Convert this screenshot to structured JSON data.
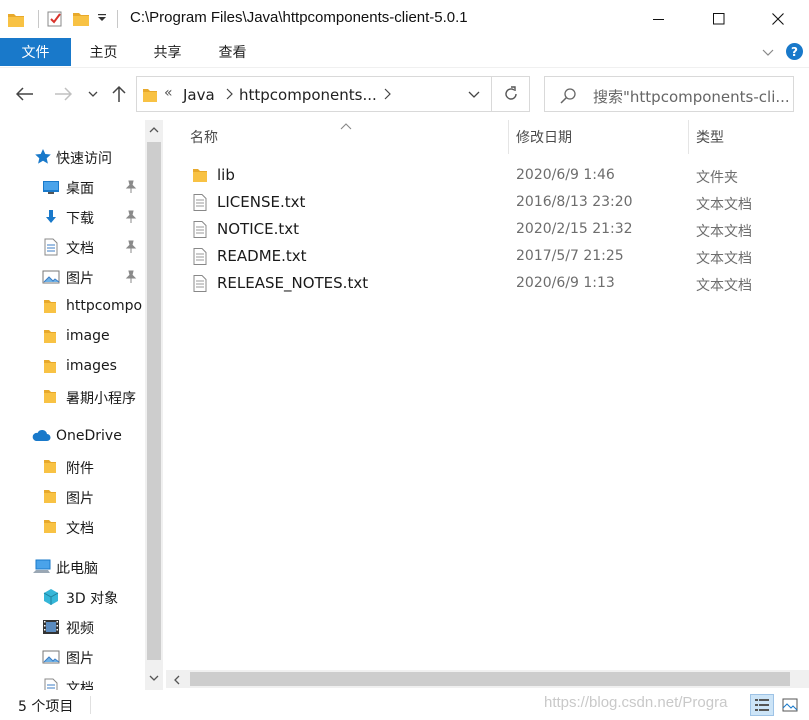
{
  "window": {
    "title": "C:\\Program Files\\Java\\httpcomponents-client-5.0.1"
  },
  "ribbon": {
    "tabs": [
      {
        "label": "文件"
      },
      {
        "label": "主页"
      },
      {
        "label": "共享"
      },
      {
        "label": "查看"
      }
    ],
    "help_label": "?"
  },
  "address": {
    "overflow": "«",
    "crumbs": [
      "Java",
      "httpcomponents..."
    ]
  },
  "search": {
    "placeholder": "搜索\"httpcomponents-cli..."
  },
  "navpane": {
    "items": [
      {
        "label": "快速访问",
        "icon": "star-icon"
      },
      {
        "label": "桌面",
        "icon": "desktop-icon",
        "pinned": true
      },
      {
        "label": "下载",
        "icon": "download-icon",
        "pinned": true
      },
      {
        "label": "文档",
        "icon": "document-icon",
        "pinned": true
      },
      {
        "label": "图片",
        "icon": "picture-icon",
        "pinned": true
      },
      {
        "label": "httpcompo",
        "icon": "folder-icon"
      },
      {
        "label": "image",
        "icon": "folder-icon"
      },
      {
        "label": "images",
        "icon": "folder-icon"
      },
      {
        "label": "暑期小程序",
        "icon": "folder-icon"
      },
      {
        "label": "OneDrive",
        "icon": "cloud-icon"
      },
      {
        "label": "附件",
        "icon": "folder-icon"
      },
      {
        "label": "图片",
        "icon": "folder-icon"
      },
      {
        "label": "文档",
        "icon": "folder-icon"
      },
      {
        "label": "此电脑",
        "icon": "computer-icon"
      },
      {
        "label": "3D 对象",
        "icon": "cube-icon"
      },
      {
        "label": "视频",
        "icon": "video-icon"
      },
      {
        "label": "图片",
        "icon": "picture-icon"
      },
      {
        "label": "文档",
        "icon": "document-icon"
      }
    ]
  },
  "columns": {
    "name": "名称",
    "date": "修改日期",
    "type": "类型"
  },
  "files": [
    {
      "name": "lib",
      "date": "2020/6/9 1:46",
      "type": "文件夹",
      "kind": "folder"
    },
    {
      "name": "LICENSE.txt",
      "date": "2016/8/13 23:20",
      "type": "文本文档",
      "kind": "text"
    },
    {
      "name": "NOTICE.txt",
      "date": "2020/2/15 21:32",
      "type": "文本文档",
      "kind": "text"
    },
    {
      "name": "README.txt",
      "date": "2017/5/7 21:25",
      "type": "文本文档",
      "kind": "text"
    },
    {
      "name": "RELEASE_NOTES.txt",
      "date": "2020/6/9 1:13",
      "type": "文本文档",
      "kind": "text"
    }
  ],
  "status": {
    "count": "5 个项目",
    "watermark": "https://blog.csdn.net/Progra"
  },
  "colors": {
    "accent": "#1979ca",
    "folder": "#f8c244",
    "selected_view_bg": "#cce4f7"
  }
}
